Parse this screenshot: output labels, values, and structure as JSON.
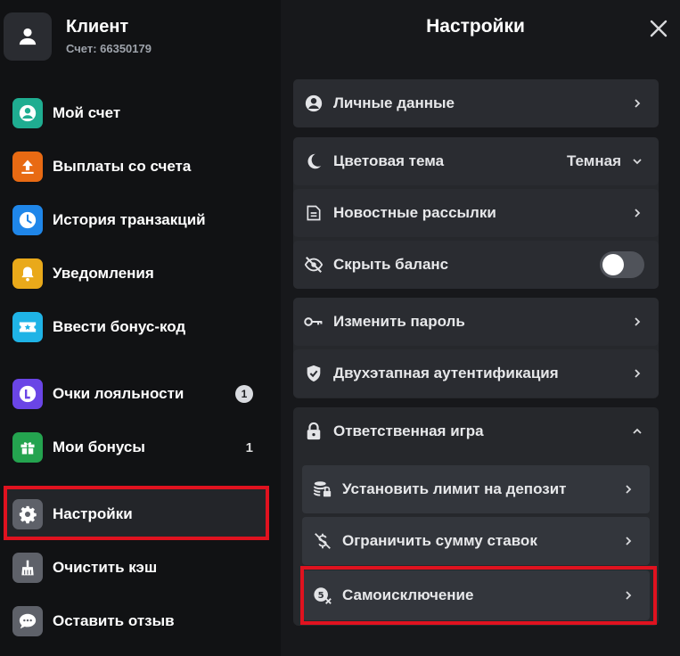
{
  "profile": {
    "name": "Клиент",
    "account": "Счет: 66350179"
  },
  "sidebar": {
    "items": [
      {
        "label": "Мой счет",
        "icon": "account-circle-icon",
        "color": "#1fad91"
      },
      {
        "label": "Выплаты со счета",
        "icon": "upload-icon",
        "color": "#e86a13"
      },
      {
        "label": "История транзакций",
        "icon": "clock-icon",
        "color": "#1f86e9"
      },
      {
        "label": "Уведомления",
        "icon": "bell-icon",
        "color": "#e9a91a"
      },
      {
        "label": "Ввести бонус-код",
        "icon": "ticket-star-icon",
        "color": "#1fb3e6"
      },
      {
        "label": "Очки лояльности",
        "icon": "loyalty-l-icon",
        "color": "#6a45e6",
        "count": "1"
      },
      {
        "label": "Мои бонусы",
        "icon": "gift-icon",
        "color": "#24a34f",
        "count": "1"
      },
      {
        "label": "Настройки",
        "icon": "gear-icon",
        "color": "#5e6169"
      },
      {
        "label": "Очистить кэш",
        "icon": "broom-icon",
        "color": "#5e6169"
      },
      {
        "label": "Оставить отзыв",
        "icon": "chat-bubble-icon",
        "color": "#5e6169"
      }
    ]
  },
  "panel": {
    "title": "Настройки",
    "rows": {
      "personal": "Личные данные",
      "theme": "Цветовая тема",
      "theme_value": "Темная",
      "newsletters": "Новостные рассылки",
      "hide_balance": "Скрыть баланс",
      "change_password": "Изменить пароль",
      "two_factor": "Двухэтапная аутентификация",
      "responsible": "Ответственная игра",
      "deposit_limit": "Установить лимит на депозит",
      "bet_limit": "Ограничить сумму ставок",
      "self_exclusion": "Самоисключение"
    },
    "hide_balance_on": false
  },
  "colors": {
    "highlight": "#e0121f",
    "background": "#111214",
    "row": "#2a2c31"
  }
}
